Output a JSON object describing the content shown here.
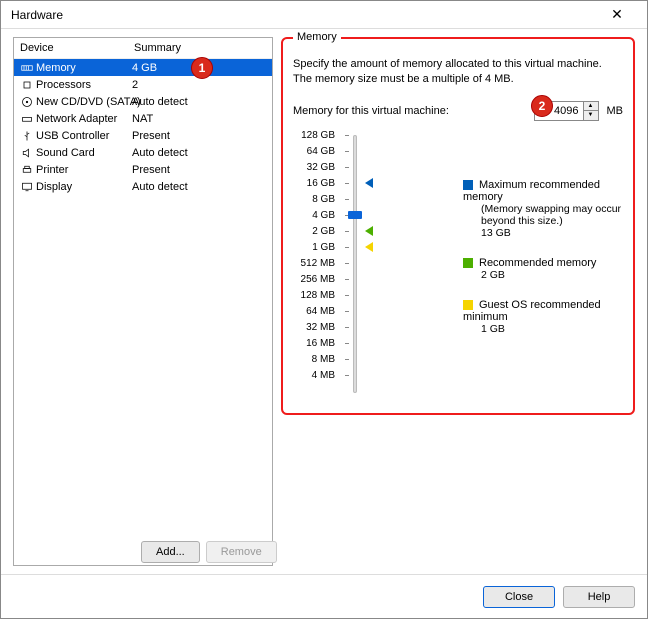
{
  "window": {
    "title": "Hardware",
    "closeGlyph": "✕"
  },
  "columns": {
    "device": "Device",
    "summary": "Summary"
  },
  "devices": [
    {
      "name": "Memory",
      "summary": "4 GB",
      "selected": true,
      "icon": "memory"
    },
    {
      "name": "Processors",
      "summary": "2",
      "icon": "cpu"
    },
    {
      "name": "New CD/DVD (SATA)",
      "summary": "Auto detect",
      "icon": "disc"
    },
    {
      "name": "Network Adapter",
      "summary": "NAT",
      "icon": "net"
    },
    {
      "name": "USB Controller",
      "summary": "Present",
      "icon": "usb"
    },
    {
      "name": "Sound Card",
      "summary": "Auto detect",
      "icon": "sound"
    },
    {
      "name": "Printer",
      "summary": "Present",
      "icon": "printer"
    },
    {
      "name": "Display",
      "summary": "Auto detect",
      "icon": "display"
    }
  ],
  "leftButtons": {
    "add": "Add...",
    "remove": "Remove"
  },
  "memory": {
    "groupTitle": "Memory",
    "desc": "Specify the amount of memory allocated to this virtual machine. The memory size must be a multiple of 4 MB.",
    "inputLabel": "Memory for this virtual machine:",
    "value": "4096",
    "unit": "MB",
    "ticks": [
      "128 GB",
      "64 GB",
      "32 GB",
      "16 GB",
      "8 GB",
      "4 GB",
      "2 GB",
      "1 GB",
      "512 MB",
      "256 MB",
      "128 MB",
      "64 MB",
      "32 MB",
      "16 MB",
      "8 MB",
      "4 MB"
    ],
    "thumbIndex": 5,
    "markers": {
      "blue": 3,
      "green": 6,
      "yellow": 7
    },
    "legend": {
      "max": {
        "label": "Maximum recommended memory",
        "sub": "(Memory swapping may occur beyond this size.)",
        "value": "13 GB"
      },
      "rec": {
        "label": "Recommended memory",
        "value": "2 GB"
      },
      "min": {
        "label": "Guest OS recommended minimum",
        "value": "1 GB"
      }
    }
  },
  "bottom": {
    "close": "Close",
    "help": "Help"
  },
  "badges": {
    "one": "1",
    "two": "2"
  }
}
